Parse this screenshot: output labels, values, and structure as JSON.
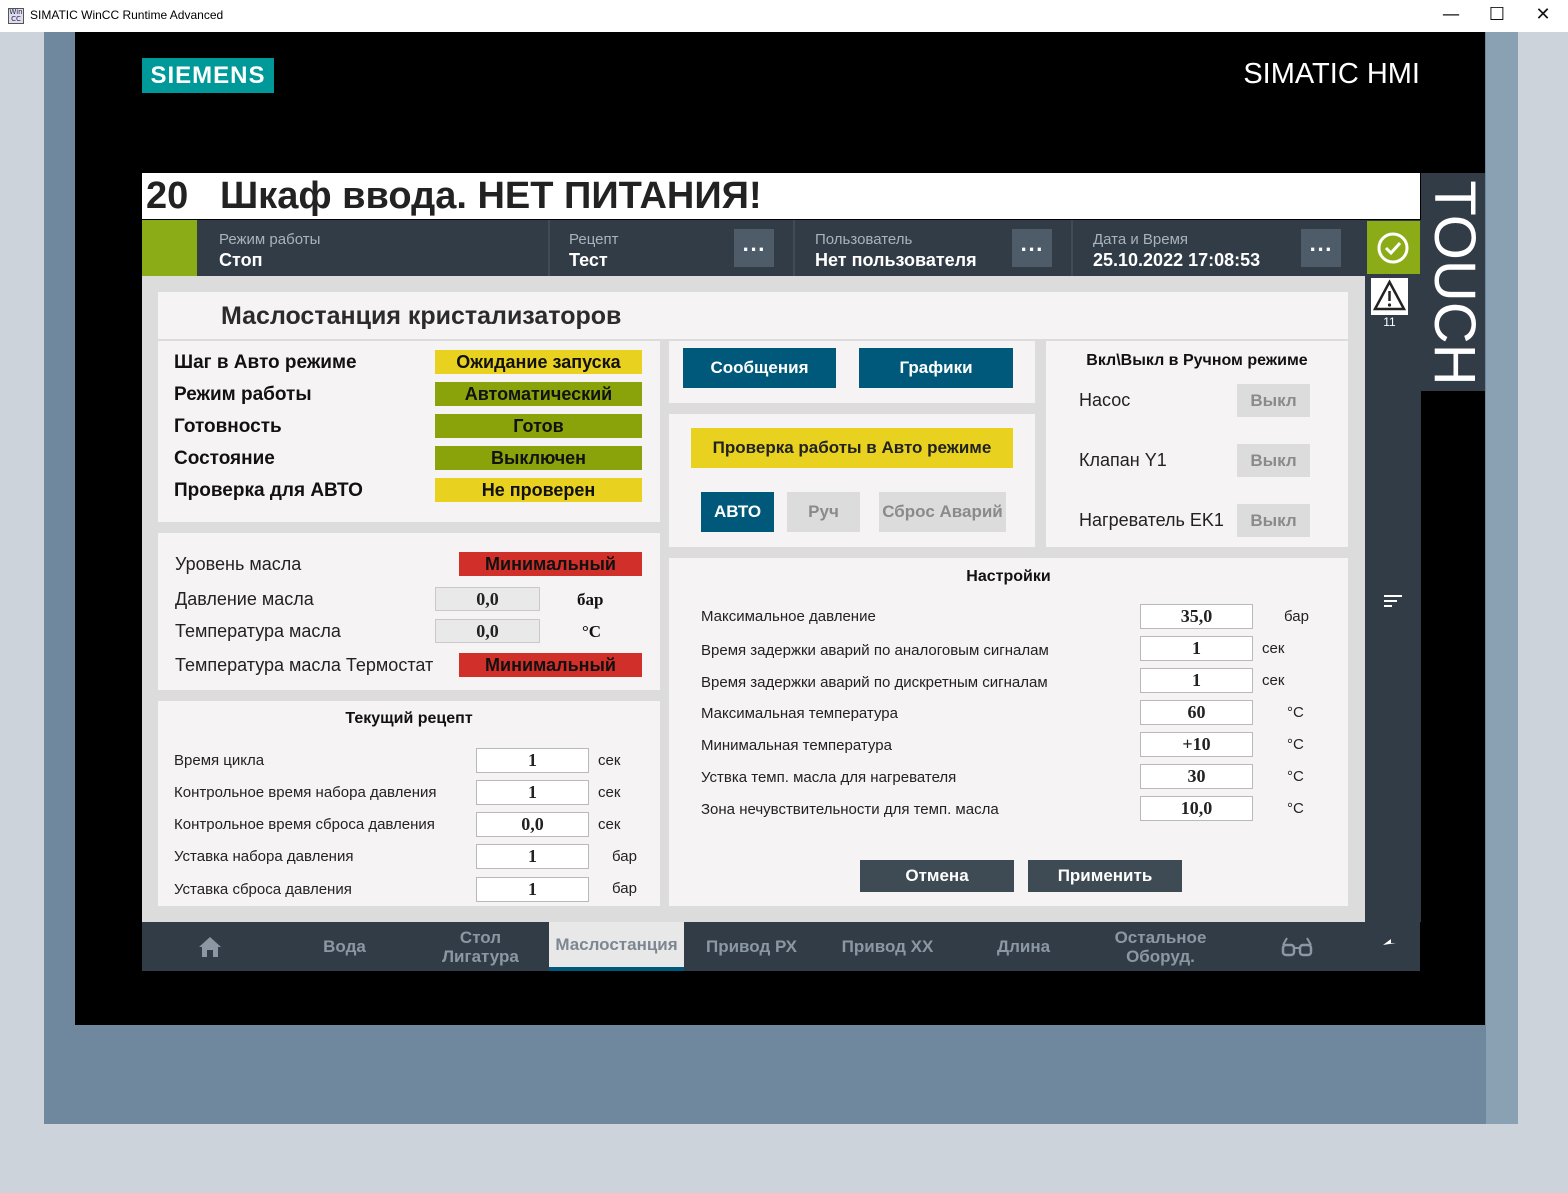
{
  "window": {
    "title": "SIMATIC WinCC Runtime Advanced",
    "minimize": "—",
    "maximize": "☐",
    "close": "✕"
  },
  "brand": {
    "logo": "SIEMENS",
    "product": "SIMATIC HMI",
    "touch": "TOUCH"
  },
  "alarm": {
    "number": "20",
    "text": "Шкаф ввода. НЕТ ПИТАНИЯ!"
  },
  "header": {
    "mode_label": "Режим работы",
    "mode_value": "Стоп",
    "recipe_label": "Рецепт",
    "recipe_value": "Тест",
    "user_label": "Пользователь",
    "user_value": "Нет пользователя",
    "datetime_label": "Дата и Время",
    "datetime_value": "25.10.2022 17:08:53",
    "dots": "..."
  },
  "side": {
    "alarm_count": "11"
  },
  "page_title": "Маслостанция кристализаторов",
  "status_panel": [
    {
      "label": "Шаг в Авто режиме",
      "value": "Ожидание запуска",
      "color": "#e8d11f"
    },
    {
      "label": "Режим работы",
      "value": "Автоматический",
      "color": "#8aa30b"
    },
    {
      "label": "Готовность",
      "value": "Готов",
      "color": "#8aa30b"
    },
    {
      "label": "Состояние",
      "value": "Выключен",
      "color": "#8aa30b"
    },
    {
      "label": "Проверка для АВТО",
      "value": "Не проверен",
      "color": "#e8d11f"
    }
  ],
  "oil_panel": {
    "level_label": "Уровень масла",
    "level_value": "Минимальный",
    "pressure_label": "Давление масла",
    "pressure_value": "0,0",
    "pressure_unit": "бар",
    "temp_label": "Температура масла",
    "temp_value": "0,0",
    "temp_unit": "°C",
    "thermostat_label": "Температура масла Термостат",
    "thermostat_value": "Минимальный"
  },
  "recipe_panel": {
    "title": "Текущий рецепт",
    "rows": [
      {
        "label": "Время цикла",
        "value": "1",
        "unit": "сек"
      },
      {
        "label": "Контрольное время набора давления",
        "value": "1",
        "unit": "сек"
      },
      {
        "label": "Контрольное время сброса давления",
        "value": "0,0",
        "unit": "сек"
      },
      {
        "label": "Уставка набора давления",
        "value": "1",
        "unit": "бар"
      },
      {
        "label": "Уставка сброса давления",
        "value": "1",
        "unit": "бар"
      }
    ]
  },
  "buttons": {
    "messages": "Сообщения",
    "graphs": "Графики",
    "check_auto": "Проверка работы в Авто режиме",
    "auto": "АВТО",
    "manual": "Руч",
    "reset": "Сброс Аварий",
    "cancel": "Отмена",
    "apply": "Применить"
  },
  "manual_panel": {
    "title": "Вкл\\Выкл в Ручном режиме",
    "rows": [
      {
        "label": "Насос",
        "button": "Выкл"
      },
      {
        "label": "Клапан Y1",
        "button": "Выкл"
      },
      {
        "label": "Нагреватель EK1",
        "button": "Выкл"
      }
    ]
  },
  "settings_panel": {
    "title": "Настройки",
    "rows": [
      {
        "label": "Максимальное давление",
        "value": "35,0",
        "unit": "бар"
      },
      {
        "label": "Время задержки аварий по аналоговым сигналам",
        "value": "1",
        "unit": "сек"
      },
      {
        "label": "Время задержки аварий по дискретным сигналам",
        "value": "1",
        "unit": "сек"
      },
      {
        "label": "Максимальная температура",
        "value": "60",
        "unit": "°C"
      },
      {
        "label": "Минимальная температура",
        "value": "+10",
        "unit": "°C"
      },
      {
        "label": "Уствка темп. масла для нагревателя",
        "value": "30",
        "unit": "°C"
      },
      {
        "label": "Зона нечувствительности для темп. масла",
        "value": "10,0",
        "unit": "°C"
      }
    ]
  },
  "nav": {
    "home_icon": "home-icon",
    "items": [
      "Вода",
      "Стол Лигатура",
      "Маслостанция",
      "Привод РХ",
      "Привод ХХ",
      "Длина",
      "Остальное Оборуд."
    ],
    "active": "Маслостанция",
    "glasses_icon": "glasses-icon",
    "back_icon": "back-arrow-icon"
  },
  "colors": {
    "accent_green": "#8bac16",
    "dark": "#323c47",
    "blue": "#00597a",
    "siemens": "#009999"
  }
}
